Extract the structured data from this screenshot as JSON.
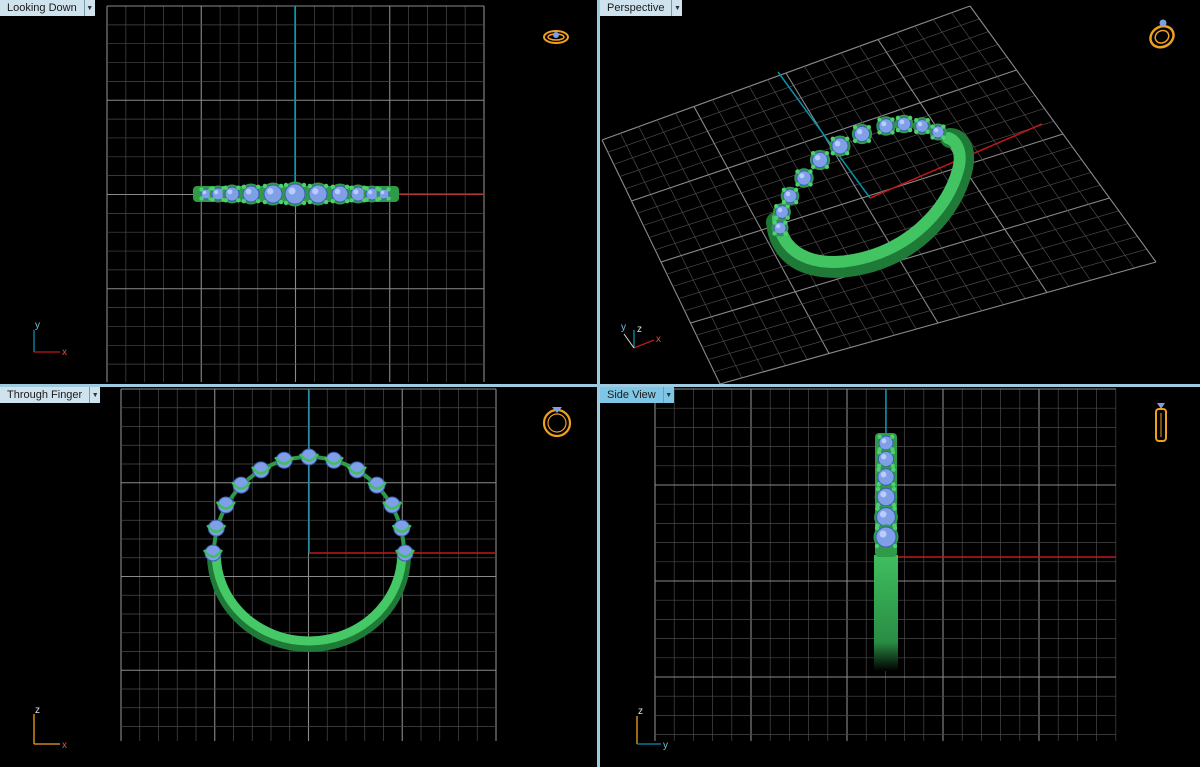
{
  "viewports": [
    {
      "id": "top",
      "label": "Looking Down",
      "axes": {
        "vertical": "y",
        "horizontal": "x"
      },
      "orientation_icon": "ring-top-view-icon"
    },
    {
      "id": "perspective",
      "label": "Perspective",
      "axes": {
        "vertical": "z",
        "horizontal": "x",
        "depth": "y"
      },
      "orientation_icon": "ring-perspective-icon"
    },
    {
      "id": "front",
      "label": "Through Finger",
      "axes": {
        "vertical": "z",
        "horizontal": "x"
      },
      "orientation_icon": "ring-front-view-icon"
    },
    {
      "id": "side",
      "label": "Side View",
      "axes": {
        "vertical": "z",
        "horizontal": "y"
      },
      "orientation_icon": "ring-side-view-icon"
    }
  ],
  "active_viewport": "side",
  "colors": {
    "background": "#000000",
    "grid": "#6e6e6e",
    "x_axis": "#c01818",
    "y_axis": "#0b8fa8",
    "ring": "#3fbf5f",
    "gem": "#7f9fe6",
    "icon": "#f0a020",
    "label_bg": "#cfe3ef",
    "active_label_bg": "#7fc6e6",
    "divider": "#9ecbe0"
  }
}
